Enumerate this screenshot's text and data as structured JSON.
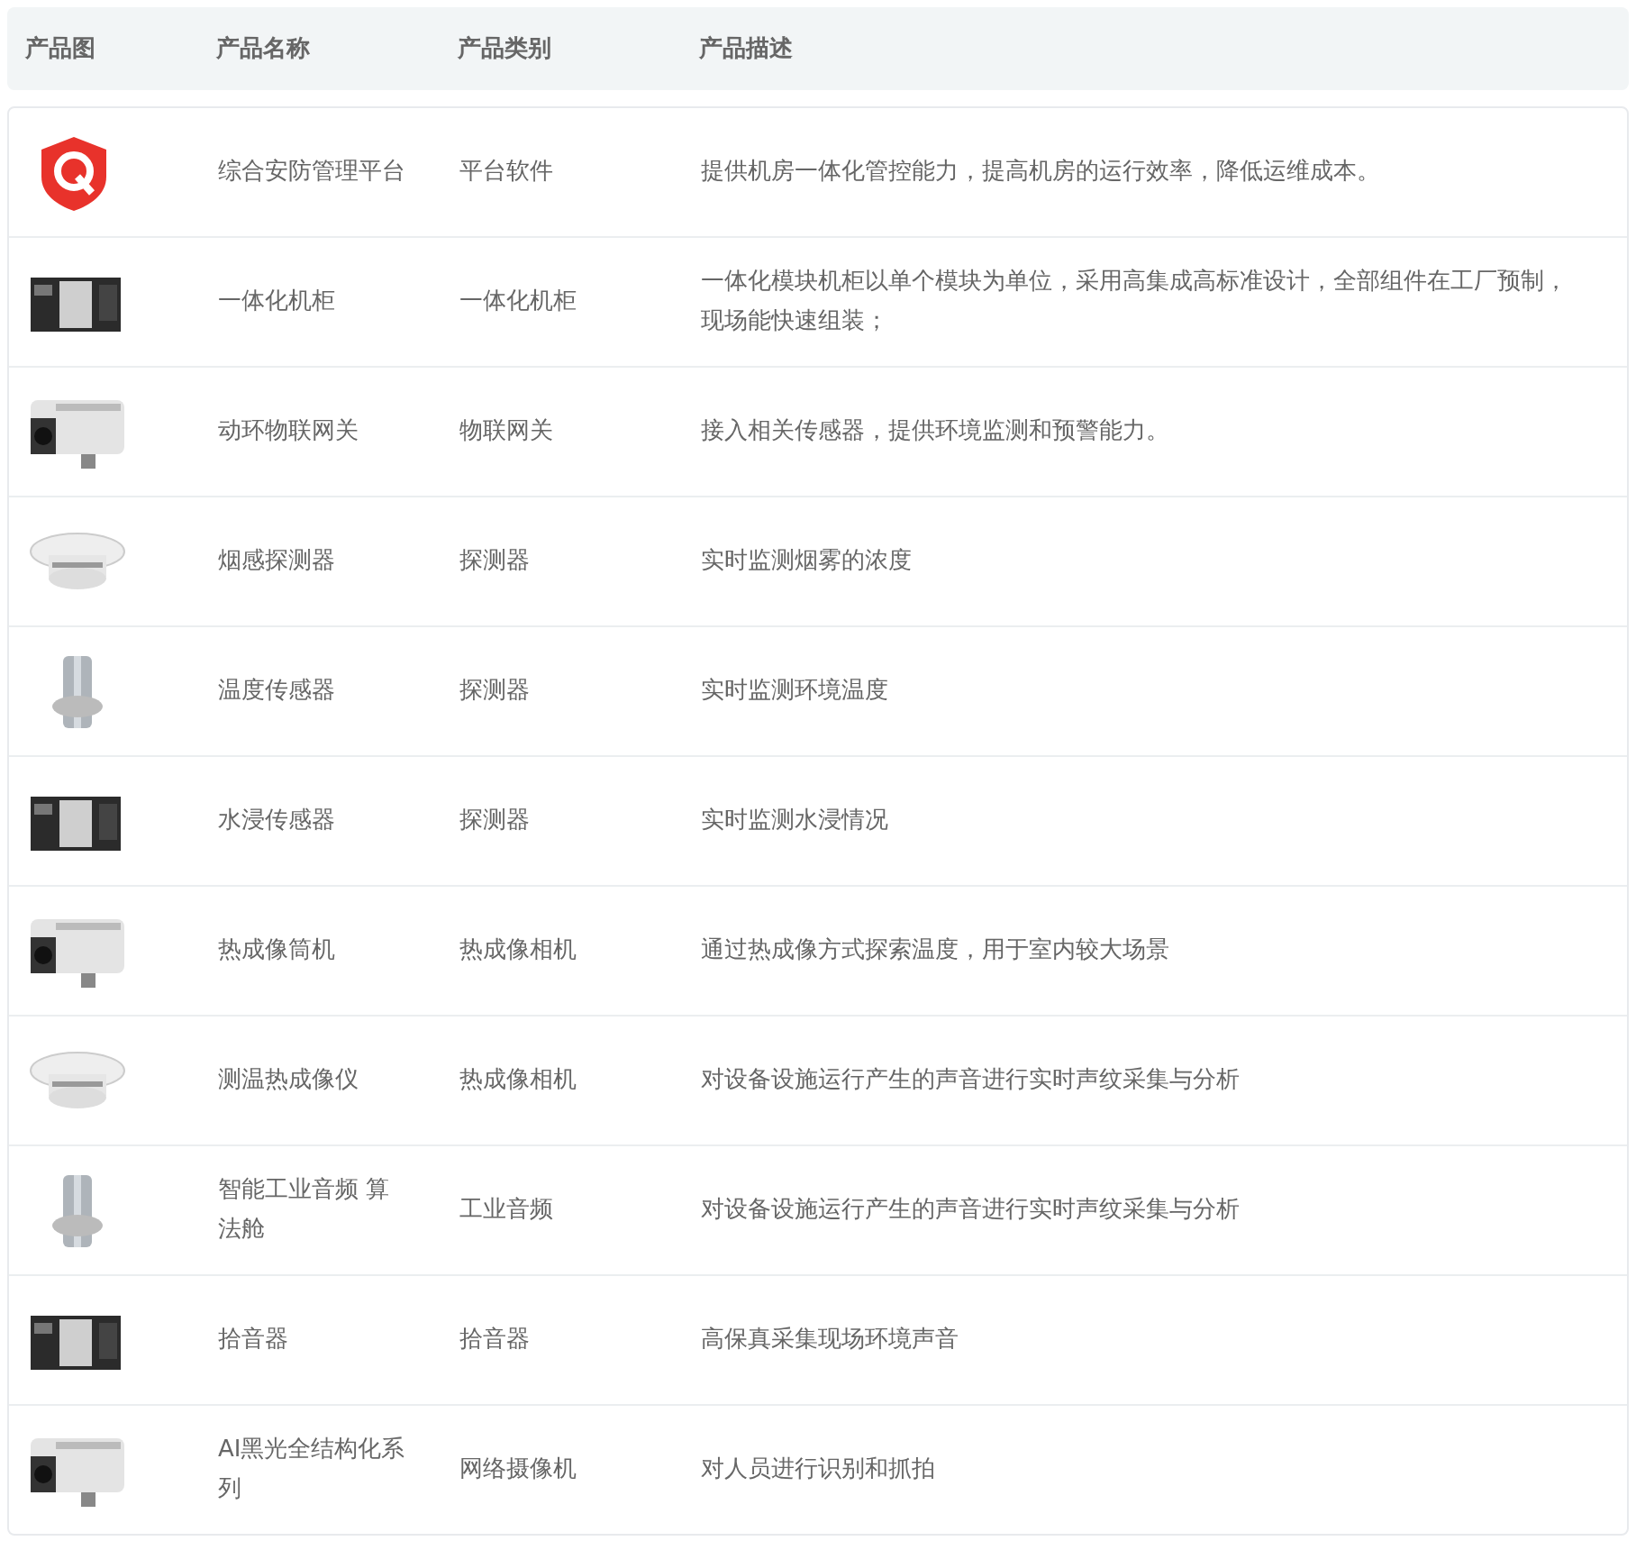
{
  "table": {
    "columns": [
      "产品图",
      "产品名称",
      "产品类别",
      "产品描述"
    ],
    "rows": [
      {
        "image": {
          "kind": "logo"
        },
        "name": "综合安防管理平台",
        "category": "平台软件",
        "description": "提供机房一体化管控能力，提高机房的运行效率，降低运维成本。"
      },
      {
        "name": "一体化机柜",
        "category": "一体化机柜",
        "description": "一体化模块机柜以单个模块为单位，采用高集成高标准设计，全部组件在工厂预制，现场能快速组装；"
      },
      {
        "name": "动环物联网关",
        "category": "物联网关",
        "description": "接入相关传感器，提供环境监测和预警能力。"
      },
      {
        "name": "烟感探测器",
        "category": "探测器",
        "description": "实时监测烟雾的浓度"
      },
      {
        "name": "温度传感器",
        "category": "探测器",
        "description": "实时监测环境温度"
      },
      {
        "name": "水浸传感器",
        "category": "探测器",
        "description": "实时监测水浸情况"
      },
      {
        "name": "热成像筒机",
        "category": "热成像相机",
        "description": "通过热成像方式探索温度，用于室内较大场景"
      },
      {
        "name": "测温热成像仪",
        "category": "热成像相机",
        "description": "对设备设施运行产生的声音进行实时声纹采集与分析"
      },
      {
        "name": "智能工业音频 算法舱",
        "category": "工业音频",
        "description": "对设备设施运行产生的声音进行实时声纹采集与分析"
      },
      {
        "name": "拾音器",
        "category": "拾音器",
        "description": "高保真采集现场环境声音"
      },
      {
        "name": "AI黑光全结构化系列",
        "category": "网络摄像机",
        "description": "对人员进行识别和抓拍"
      }
    ]
  }
}
